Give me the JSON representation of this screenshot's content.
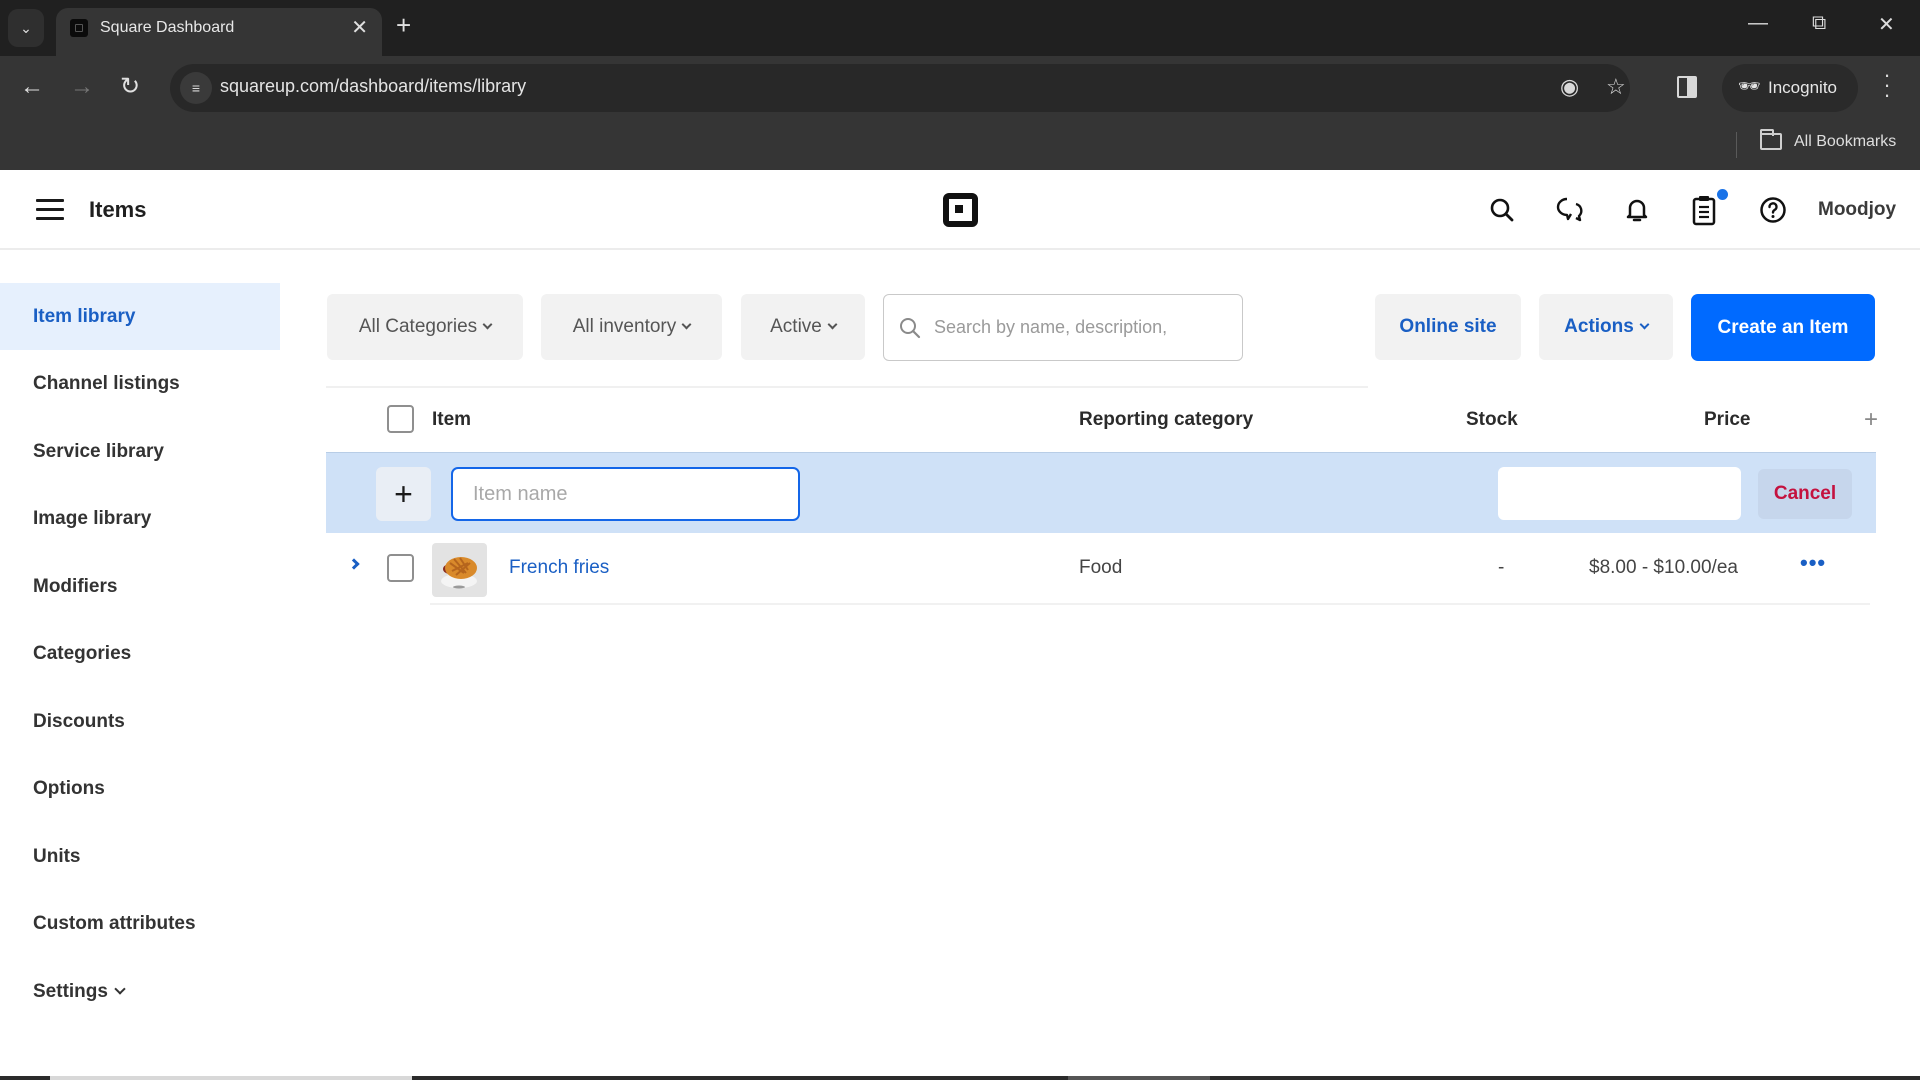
{
  "browser": {
    "tab_title": "Square Dashboard",
    "url": "squareup.com/dashboard/items/library",
    "incognito_label": "Incognito",
    "bookmarks_label": "All Bookmarks",
    "icons": [
      "tab-list-icon",
      "square-favicon-icon",
      "close-icon",
      "plus-icon",
      "minimize-icon",
      "restore-icon",
      "window-close-icon",
      "back-icon",
      "forward-icon",
      "reload-icon",
      "site-info-icon",
      "eye-off-icon",
      "star-icon",
      "side-panel-icon",
      "incognito-icon",
      "more-vert-icon",
      "folder-icon"
    ]
  },
  "header": {
    "title": "Items",
    "username": "Moodjoy",
    "accent": "#006aff",
    "notification_dot_color": "#1a73e8"
  },
  "sidebar": {
    "items": [
      {
        "label": "Item library",
        "active": true
      },
      {
        "label": "Channel listings"
      },
      {
        "label": "Service library"
      },
      {
        "label": "Image library"
      },
      {
        "label": "Modifiers"
      },
      {
        "label": "Categories"
      },
      {
        "label": "Discounts"
      },
      {
        "label": "Options"
      },
      {
        "label": "Units"
      },
      {
        "label": "Custom attributes"
      },
      {
        "label": "Settings",
        "has_dropdown": true
      }
    ]
  },
  "filters": {
    "categories": "All Categories",
    "inventory": "All inventory",
    "status": "Active",
    "search_placeholder": "Search by name, description,"
  },
  "actions": {
    "online_site": "Online site",
    "actions": "Actions",
    "create": "Create an Item"
  },
  "table": {
    "columns": [
      "Item",
      "Reporting category",
      "Stock",
      "Price"
    ],
    "quick_add": {
      "name_placeholder": "Item name",
      "name_value": "",
      "price_value": "",
      "cancel_label": "Cancel"
    },
    "rows": [
      {
        "name": "French fries",
        "reporting_category": "Food",
        "stock": "-",
        "price": "$8.00 - $10.00/ea"
      }
    ]
  }
}
